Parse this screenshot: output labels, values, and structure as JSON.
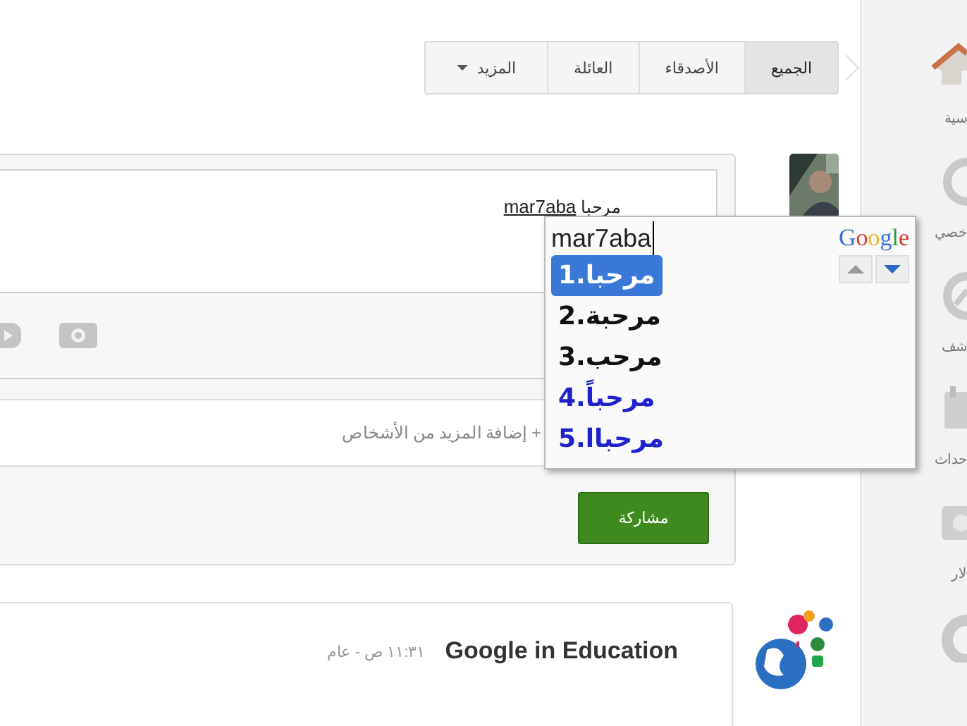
{
  "sidebar": {
    "items": [
      {
        "kind": "home",
        "label": "سية"
      },
      {
        "kind": "profile",
        "label": "خصي"
      },
      {
        "kind": "explore",
        "label": "شف"
      },
      {
        "kind": "events",
        "label": "حداث"
      },
      {
        "kind": "photos",
        "label": "لار"
      },
      {
        "kind": "circles"
      }
    ]
  },
  "tabs": [
    {
      "label": "الجميع",
      "selected": true
    },
    {
      "label": "الأصدقاء",
      "selected": false
    },
    {
      "label": "العائلة",
      "selected": false
    },
    {
      "label": "المزيد",
      "selected": false,
      "dropdown": true
    }
  ],
  "composer": {
    "text": "مرحبا",
    "composing": "mar7aba",
    "add_people": "+ إضافة المزيد من الأشخاص",
    "share_button": "مشاركة"
  },
  "ime": {
    "input": "mar7aba",
    "brand": "Google",
    "candidates": [
      {
        "text": "1.مرحبا",
        "selected": true,
        "color": "#ffffff"
      },
      {
        "text": "2.مرحبة",
        "selected": false,
        "color": "#111111"
      },
      {
        "text": "3.مرحب",
        "selected": false,
        "color": "#111111"
      },
      {
        "text": "4.مرحباً",
        "selected": false,
        "color": "#2222cc"
      },
      {
        "text": "5.مرحباا",
        "selected": false,
        "color": "#2222cc"
      }
    ]
  },
  "post": {
    "author": "Google in Education",
    "time": "١١:٣١ ص - عام"
  }
}
